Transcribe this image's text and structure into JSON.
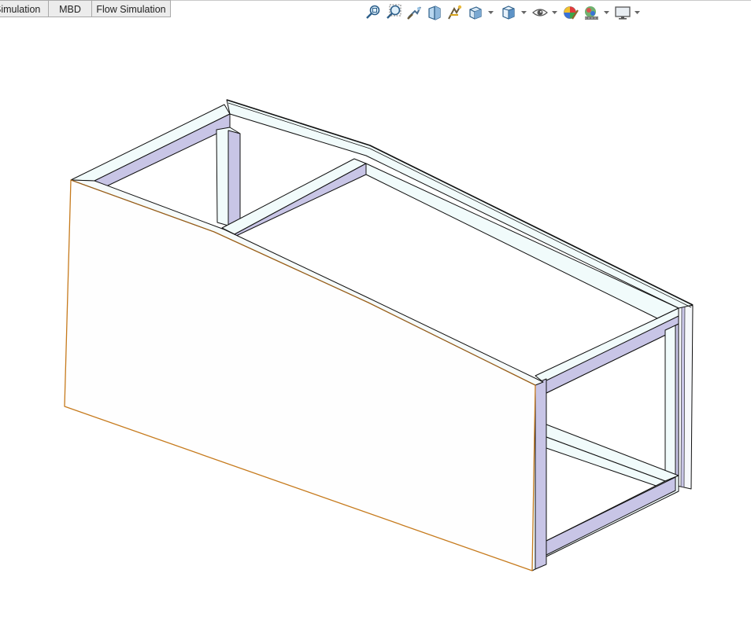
{
  "tabs": [
    {
      "label": "Simulation"
    },
    {
      "label": "MBD"
    },
    {
      "label": "Flow Simulation"
    }
  ],
  "heads_up_toolbar": {
    "icons": [
      "zoom-to-fit-icon",
      "zoom-to-area-icon",
      "previous-view-icon",
      "section-view-icon",
      "dynamic-annotation-views-icon",
      "view-orientation-icon",
      "display-style-icon",
      "hide-show-items-icon",
      "edit-appearance-icon",
      "apply-scene-icon",
      "view-settings-icon"
    ]
  },
  "model": {
    "description": "3D frame assembly",
    "colors": {
      "member_side": "#c8c5e6",
      "member_top": "#f1fbfb",
      "panel_face": "#fefefe",
      "panel_edge_highlight": "#c67a1c",
      "outline": "#111111"
    }
  }
}
